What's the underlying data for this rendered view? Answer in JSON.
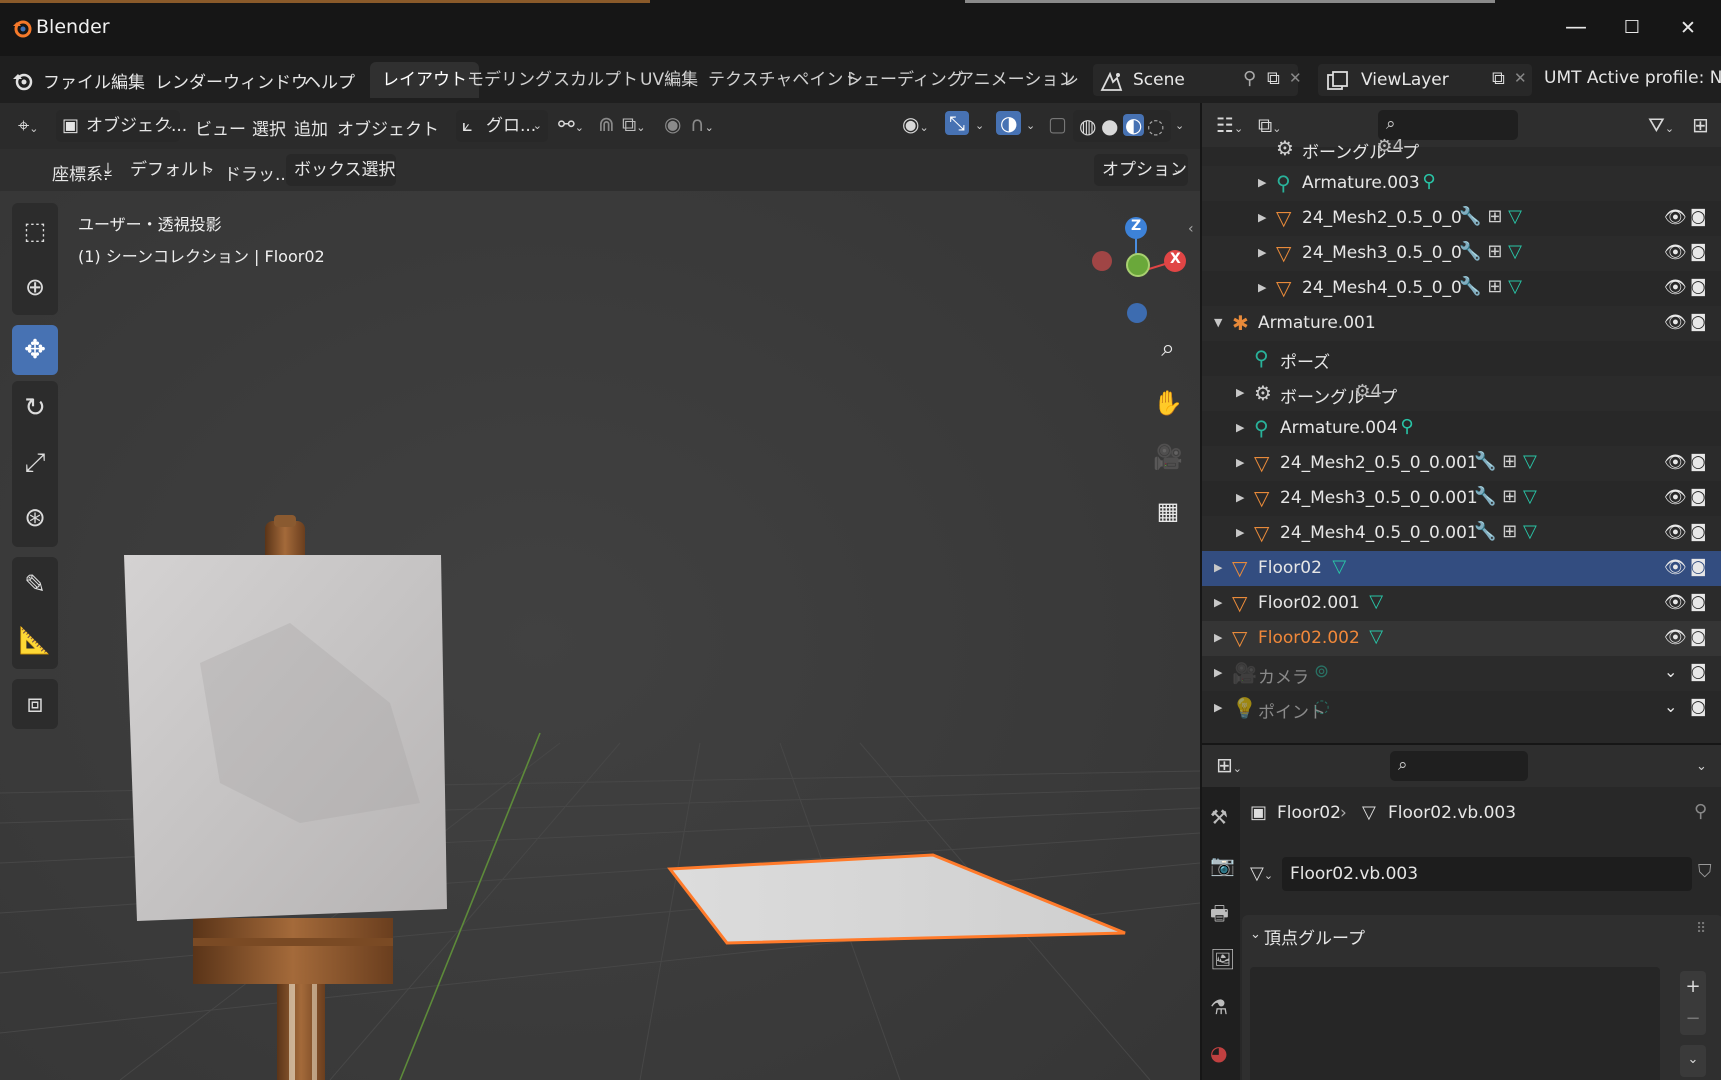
{
  "window": {
    "title": "Blender",
    "minimize": "—",
    "maximize": "☐",
    "close": "✕"
  },
  "menu": {
    "items": [
      "ファイル",
      "編集",
      "レンダー",
      "ウィンドウ",
      "ヘルプ"
    ],
    "workspaces": [
      "レイアウト",
      "モデリング",
      "スカルプト",
      "UV編集",
      "テクスチャペイント",
      "シェーディング",
      "アニメーション",
      "レ"
    ],
    "active_workspace": "レイアウト",
    "scene": "Scene",
    "view_layer": "ViewLayer",
    "profile": "UMT Active profile: None"
  },
  "viewport": {
    "mode": "オブジェク...",
    "menus": [
      "ビュー",
      "選択",
      "追加",
      "オブジェクト"
    ],
    "transform_orientation": "グロ...",
    "coord_label": "座標系:",
    "coord_value": "デフォルト",
    "drag_label": "ドラッ...",
    "select_mode": "ボックス選択",
    "options": "オプション",
    "view_name": "ユーザー・透視投影",
    "collection_info": "(1) シーンコレクション | Floor02",
    "gizmo": {
      "z": "Z",
      "x": "X"
    }
  },
  "outliner": {
    "rows": [
      {
        "label": "ボーングループ",
        "extra": "4",
        "indent": 2,
        "icon": "bone-group",
        "arrow": "",
        "vis": false
      },
      {
        "label": "Armature.003",
        "extra": "",
        "indent": 2,
        "icon": "armature",
        "arrow": "▶",
        "vis": false
      },
      {
        "label": "24_Mesh2_0.5_0_0",
        "extra": "",
        "indent": 2,
        "icon": "mesh",
        "arrow": "▶",
        "vis": true
      },
      {
        "label": "24_Mesh3_0.5_0_0",
        "extra": "",
        "indent": 2,
        "icon": "mesh",
        "arrow": "▶",
        "vis": true
      },
      {
        "label": "24_Mesh4_0.5_0_0",
        "extra": "",
        "indent": 2,
        "icon": "mesh",
        "arrow": "▶",
        "vis": true
      },
      {
        "label": "Armature.001",
        "extra": "",
        "indent": 0,
        "icon": "armature-obj",
        "arrow": "▼",
        "vis": true
      },
      {
        "label": "ポーズ",
        "extra": "",
        "indent": 1,
        "icon": "pose",
        "arrow": "",
        "vis": false
      },
      {
        "label": "ボーングループ",
        "extra": "4",
        "indent": 1,
        "icon": "bone-group",
        "arrow": "▶",
        "vis": false
      },
      {
        "label": "Armature.004",
        "extra": "",
        "indent": 1,
        "icon": "armature",
        "arrow": "▶",
        "vis": false
      },
      {
        "label": "24_Mesh2_0.5_0_0.001",
        "extra": "",
        "indent": 1,
        "icon": "mesh",
        "arrow": "▶",
        "vis": true
      },
      {
        "label": "24_Mesh3_0.5_0_0.001",
        "extra": "",
        "indent": 1,
        "icon": "mesh",
        "arrow": "▶",
        "vis": true
      },
      {
        "label": "24_Mesh4_0.5_0_0.001",
        "extra": "",
        "indent": 1,
        "icon": "mesh",
        "arrow": "▶",
        "vis": true
      },
      {
        "label": "Floor02",
        "extra": "",
        "indent": 0,
        "icon": "mesh",
        "arrow": "▶",
        "vis": true,
        "selected": true
      },
      {
        "label": "Floor02.001",
        "extra": "",
        "indent": 0,
        "icon": "mesh",
        "arrow": "▶",
        "vis": true
      },
      {
        "label": "Floor02.002",
        "extra": "",
        "indent": 0,
        "icon": "mesh",
        "arrow": "▶",
        "vis": true,
        "orange": true
      },
      {
        "label": "カメラ",
        "extra": "",
        "indent": 0,
        "icon": "camera",
        "arrow": "▶",
        "vis": "hidden",
        "dim": true
      },
      {
        "label": "ポイント",
        "extra": "",
        "indent": 0,
        "icon": "light",
        "arrow": "▶",
        "vis": "hidden",
        "dim": true
      }
    ]
  },
  "properties": {
    "breadcrumb_object": "Floor02",
    "breadcrumb_data": "Floor02.vb.003",
    "mesh_name": "Floor02.vb.003",
    "panel_title": "頂点グループ",
    "add": "+",
    "remove": "−"
  },
  "colors": {
    "accent": "#4772b3",
    "selected_row": "#334d80",
    "mesh_icon": "#e88a3a",
    "armature_icon": "#29b29a",
    "modifier_icon": "#5d8bd6",
    "selection_outline": "#ff7a2a"
  }
}
